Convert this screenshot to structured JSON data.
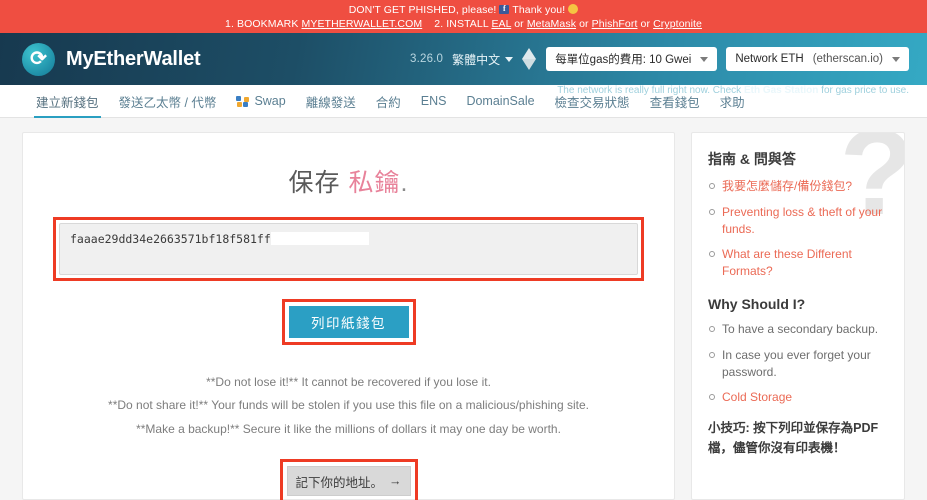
{
  "phishing_banner": {
    "line1_before": "DON'T GET PHISHED, please!",
    "line1_after": "Thank you!",
    "step1_label": "1. BOOKMARK",
    "step1_link": "MYETHERWALLET.COM",
    "step2_label": "2. INSTALL",
    "link_eal": "EAL",
    "or1": "or",
    "link_metamask": "MetaMask",
    "or2": "or",
    "link_phishfort": "PhishFort",
    "or3": "or",
    "link_cryptonite": "Cryptonite",
    "bg_color": "#ef4e41"
  },
  "header": {
    "brand": "MyEtherWallet",
    "logo_icon": "mew-swirl-logo",
    "version": "3.26.0",
    "language": "繁體中文",
    "eth_icon": "ethereum-diamond-icon",
    "gas_price": "每單位gas的費用: 10 Gwei",
    "network": "Network ETH",
    "network_suffix": "(etherscan.io)",
    "gas_note_before": "The network is really full right now. Check",
    "gas_note_link": "Eth Gas Station",
    "gas_note_after": "for gas price to use.",
    "accent_color": "#2a9fc1"
  },
  "nav": {
    "items": [
      {
        "label": "建立新錢包",
        "active": true,
        "icon": ""
      },
      {
        "label": "發送乙太幣 / 代幣",
        "active": false,
        "icon": ""
      },
      {
        "label": "Swap",
        "active": false,
        "icon": "swap-icon"
      },
      {
        "label": "離線發送",
        "active": false,
        "icon": ""
      },
      {
        "label": "合約",
        "active": false,
        "icon": ""
      },
      {
        "label": "ENS",
        "active": false,
        "icon": ""
      },
      {
        "label": "DomainSale",
        "active": false,
        "icon": ""
      },
      {
        "label": "檢查交易狀態",
        "active": false,
        "icon": ""
      },
      {
        "label": "查看錢包",
        "active": false,
        "icon": ""
      },
      {
        "label": "求助",
        "active": false,
        "icon": ""
      }
    ]
  },
  "main": {
    "title_prefix": "保存",
    "title_highlight": "私鑰",
    "title_suffix": ".",
    "private_key": "faaae29dd34e2663571bf18f581ff",
    "private_key_placeholder": "",
    "print_button": "列印紙錢包",
    "warnings": [
      "**Do not lose it!** It cannot be recovered if you lose it.",
      "**Do not share it!** Your funds will be stolen if you use this file on a malicious/phishing site.",
      "**Make a backup!** Secure it like the millions of dollars it may one day be worth."
    ],
    "next_button": "記下你的地址。",
    "next_arrow": "→",
    "highlight_border_color": "#ee3b24"
  },
  "sidebar": {
    "watermark": "?",
    "section1_title": "指南 & 問與答",
    "section1_items": [
      {
        "text": "我要怎麼儲存/備份錢包?",
        "link": true
      },
      {
        "text": "Preventing loss & theft of your funds.",
        "link": true
      },
      {
        "text": "What are these Different Formats?",
        "link": true
      }
    ],
    "section2_title": "Why Should I?",
    "section2_items": [
      {
        "text": "To have a secondary backup.",
        "link": false
      },
      {
        "text": "In case you ever forget your password.",
        "link": false
      },
      {
        "text": "Cold Storage",
        "link": true
      }
    ],
    "tip": "小技巧: 按下列印並保存為PDF檔，儘管你沒有印表機！",
    "link_color": "#eb6a55"
  }
}
